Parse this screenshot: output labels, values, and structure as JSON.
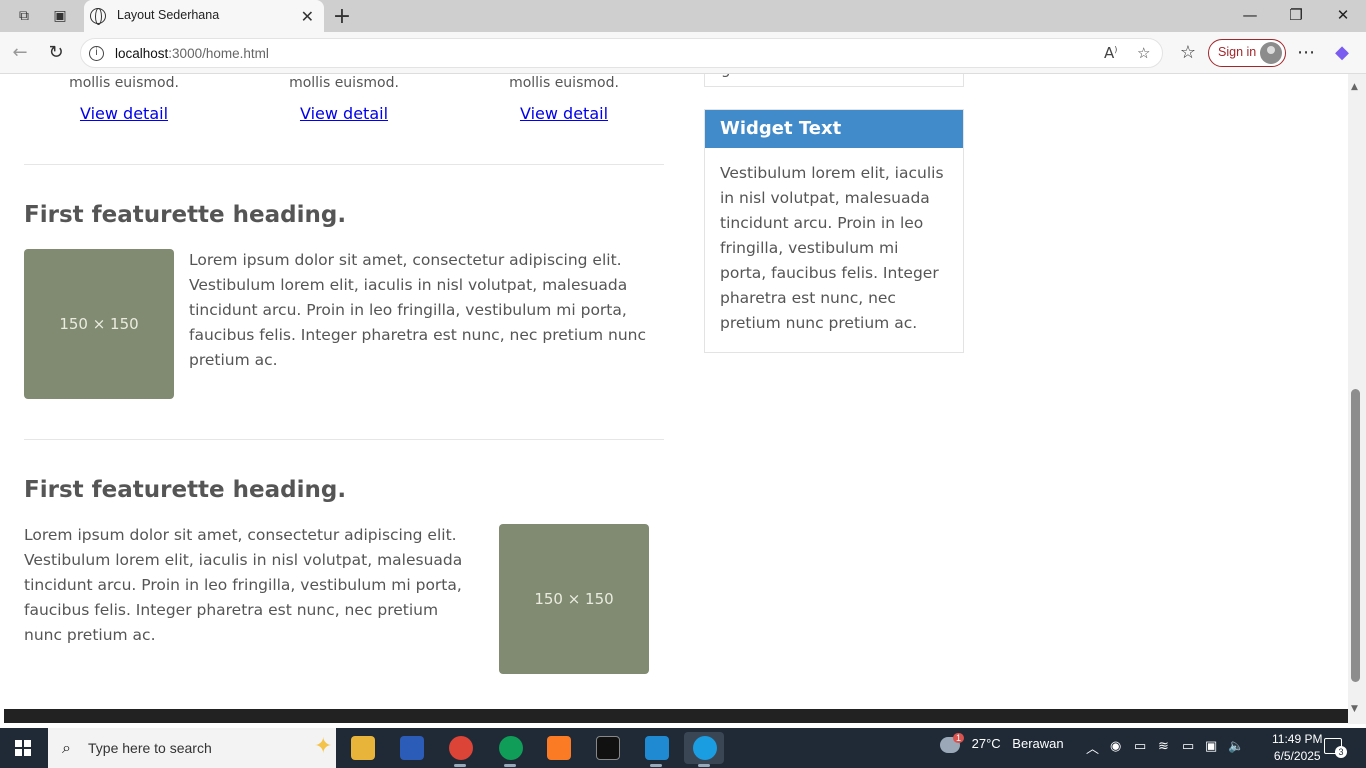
{
  "browser": {
    "tab_title": "Layout Sederhana",
    "url_host": "localhost",
    "url_path": ":3000/home.html",
    "signin_label": "Sign in"
  },
  "page": {
    "columns": [
      {
        "snippet": "mollis euismod.",
        "link": "View detail"
      },
      {
        "snippet": "mollis euismod.",
        "link": "View detail"
      },
      {
        "snippet": "mollis euismod.",
        "link": "View detail"
      }
    ],
    "featurettes": [
      {
        "heading": "First featurette heading.",
        "image_label": "150 × 150",
        "text": "Lorem ipsum dolor sit amet, consectetur adipiscing elit. Vestibulum lorem elit, iaculis in nisl volutpat, malesuada tincidunt arcu. Proin in leo fringilla, vestibulum mi porta, faucibus felis. Integer pharetra est nunc, nec pretium nunc pretium ac."
      },
      {
        "heading": "First featurette heading.",
        "image_label": "150 × 150",
        "text": "Lorem ipsum dolor sit amet, consectetur adipiscing elit. Vestibulum lorem elit, iaculis in nisl volutpat, malesuada tincidunt arcu. Proin in leo fringilla, vestibulum mi porta, faucibus felis. Integer pharetra est nunc, nec pretium nunc pretium ac."
      }
    ],
    "widget_above_partial": "g",
    "widget": {
      "title": "Widget Text",
      "body": "Vestibulum lorem elit, iaculis in nisl volutpat, malesuada tincidunt arcu. Proin in leo fringilla, vestibulum mi porta, faucibus felis. Integer pharetra est nunc, nec pretium nunc pretium ac."
    }
  },
  "taskbar": {
    "search_placeholder": "Type here to search",
    "weather_temp": "27°C",
    "weather_text": "Berawan",
    "weather_badge": "1",
    "time": "11:49 PM",
    "date": "6/5/2025",
    "notification_count": "3"
  },
  "colors": {
    "widget_header": "#428bca",
    "placeholder": "#808b72",
    "signin_accent": "#a2262a",
    "taskbar": "#1f2a36"
  }
}
